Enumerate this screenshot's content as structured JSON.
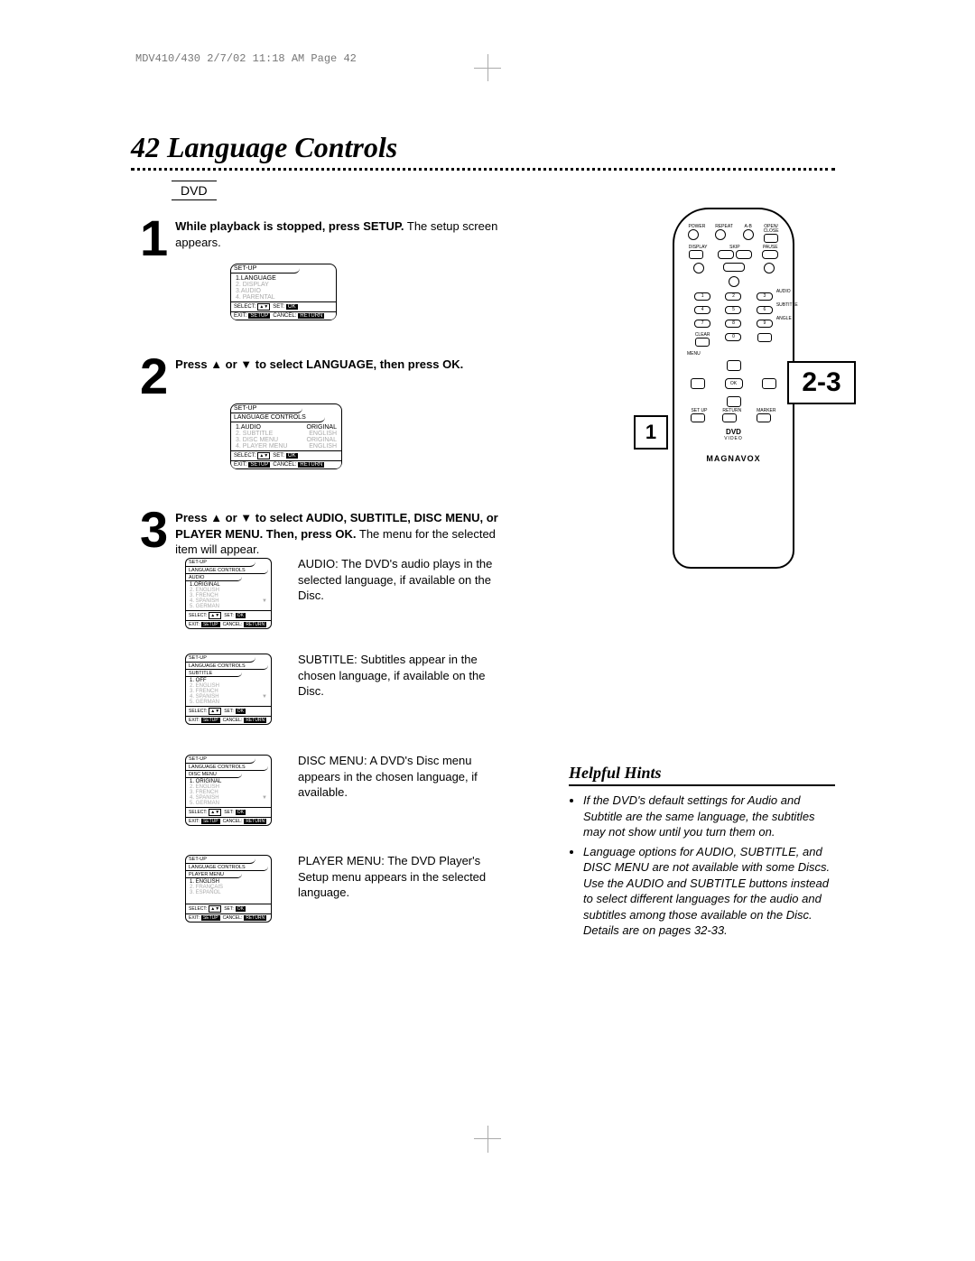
{
  "header": "MDV410/430  2/7/02  11:18 AM  Page 42",
  "page_number": "42",
  "title": "Language Controls",
  "section_label": "DVD",
  "step1": {
    "num": "1",
    "bold": "While playback is stopped, press SETUP.",
    "rest": " The setup screen appears.",
    "diagram": {
      "tab": "SET-UP",
      "items": [
        "1.LANGUAGE",
        "2. DISPLAY",
        "3.AUDIO",
        "4. PARENTAL"
      ],
      "foot_select": "SELECT:",
      "foot_set": "SET:",
      "foot_exit": "EXIT:",
      "foot_cancel": "CANCEL:",
      "foot_setup": "SETUP",
      "foot_ok": "OK",
      "foot_return": "RETURN"
    }
  },
  "step2": {
    "num": "2",
    "bold": "Press ▲ or ▼ to select LANGUAGE, then press OK.",
    "diagram": {
      "tab": "SET-UP",
      "tab2": "LANGUAGE CONTROLS",
      "items": [
        {
          "l": "1.AUDIO",
          "r": "ORIGINAL"
        },
        {
          "l": "2. SUBTITLE",
          "r": "ENGLISH"
        },
        {
          "l": "3. DISC MENU",
          "r": "ORIGINAL"
        },
        {
          "l": "4. PLAYER MENU",
          "r": "ENGLISH"
        }
      ],
      "foot_select": "SELECT:",
      "foot_set": "SET:",
      "foot_exit": "EXIT:",
      "foot_cancel": "CANCEL:",
      "foot_setup": "SETUP",
      "foot_ok": "OK",
      "foot_return": "RETURN"
    }
  },
  "step3": {
    "num": "3",
    "bold1": "Press ▲ or ▼ to select AUDIO, SUBTITLE, DISC MENU, or PLAYER MENU. Then, press OK.",
    "rest": " The menu for the selected item will appear."
  },
  "sub1": {
    "text": "AUDIO: The DVD's audio plays in the selected language, if available on the Disc.",
    "tab": "SET-UP",
    "tab2": "LANGUAGE CONTROLS",
    "tab3": "AUDIO",
    "items": [
      "1.ORIGINAL",
      "2. ENGLISH",
      "3. FRENCH",
      "4. SPANISH",
      "5. GERMAN"
    ]
  },
  "sub2": {
    "text": "SUBTITLE: Subtitles appear in the chosen language, if available on the Disc.",
    "tab": "SET-UP",
    "tab2": "LANGUAGE CONTROLS",
    "tab3": "SUBTITLE",
    "items": [
      "1. OFF",
      "2. ENGLISH",
      "3. FRENCH",
      "4. SPANISH",
      "5. GERMAN"
    ]
  },
  "sub3": {
    "text": "DISC MENU: A DVD's Disc menu appears in the chosen language, if available.",
    "tab": "SET-UP",
    "tab2": "LANGUAGE CONTROLS",
    "tab3": "DISC MENU",
    "items": [
      "1. ORIGINAL",
      "2. ENGLISH",
      "3. FRENCH",
      "4. SPANISH",
      "5. GERMAN"
    ]
  },
  "sub4": {
    "text": "PLAYER MENU: The DVD Player's Setup menu appears in the selected language.",
    "tab": "SET-UP",
    "tab2": "LANGUAGE CONTROLS",
    "tab3": "PLAYER MENU",
    "items": [
      "1. ENGLISH",
      "2. FRANÇAIS",
      "3. ESPAÑOL"
    ]
  },
  "callout1": "1",
  "callout23": "2-3",
  "remote": {
    "labels": {
      "power": "POWER",
      "repeat": "REPEAT",
      "ab": "A-B",
      "open": "OPEN/\nCLOSE",
      "display": "DISPLAY",
      "skip": "SKIP",
      "pause": "PAUSE",
      "audio": "AUDIO",
      "subtitle": "SUBTITLE",
      "angle": "ANGLE",
      "clear": "CLEAR",
      "menu": "MENU",
      "ok": "OK",
      "setup": "SET UP",
      "return": "RETURN",
      "marker": "MARKER"
    },
    "nums": [
      "1",
      "2",
      "3",
      "4",
      "5",
      "6",
      "7",
      "8",
      "9",
      "",
      "0",
      ""
    ],
    "brand": "MAGNAVOX",
    "dvd": "DVD",
    "dvd_sub": "VIDEO"
  },
  "hints": {
    "title": "Helpful Hints",
    "items": [
      "If the DVD's default settings for Audio and Subtitle are the same language, the subtitles may not show until you turn them on.",
      "Language options for AUDIO, SUBTITLE, and DISC MENU are not available with some Discs. Use the AUDIO and SUBTITLE buttons instead to select different languages for the audio and subtitles among those available on the Disc. Details are on pages 32-33."
    ]
  },
  "arrows": "▲▼",
  "tri": "▼"
}
